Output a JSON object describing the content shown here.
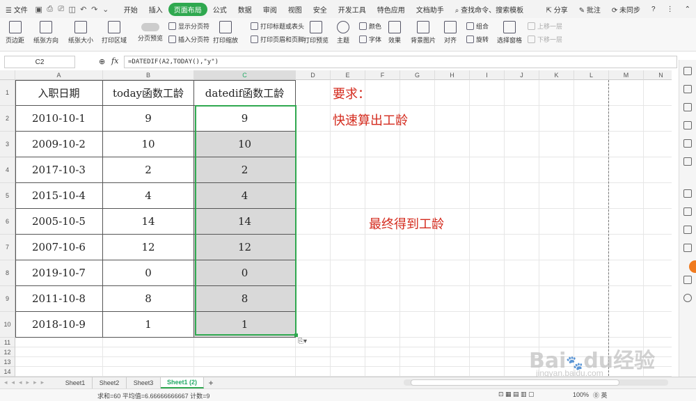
{
  "menu": {
    "file": "文件",
    "tabs": [
      "开始",
      "插入",
      "页面布局",
      "公式",
      "数据",
      "审阅",
      "视图",
      "安全",
      "开发工具",
      "特色应用",
      "文档助手"
    ],
    "active_tab": "页面布局",
    "search_placeholder": "查找命令、搜索模板",
    "share": "分享",
    "comment": "批注",
    "sync": "未同步",
    "help": "?"
  },
  "ribbon": {
    "margins": "页边距",
    "orientation": "纸张方向",
    "size": "纸张大小",
    "print_area": "打印区域",
    "page_break_preview": "分页预览",
    "show_page_break": "显示分页符",
    "insert_page_break": "插入分页符",
    "print_scale": "打印缩放",
    "print_titles": "打印标题或表头",
    "print_header_footer": "打印页眉和页脚",
    "print_preview": "打印预览",
    "theme": "主题",
    "colors": "颜色",
    "fonts": "字体",
    "effects": "效果",
    "background": "背景图片",
    "align": "对齐",
    "group": "组合",
    "rotate": "旋转",
    "selection_pane": "选择窗格",
    "bring_forward": "上移一层",
    "send_backward": "下移一层"
  },
  "formula_bar": {
    "name_box": "C2",
    "fx": "fx",
    "formula": "=DATEDIF(A2,TODAY(),\"y\")"
  },
  "columns": [
    "A",
    "B",
    "C",
    "D",
    "E",
    "F",
    "G",
    "H",
    "I",
    "J",
    "K",
    "L",
    "M",
    "N"
  ],
  "rows": [
    "1",
    "2",
    "3",
    "4",
    "5",
    "6",
    "7",
    "8",
    "9",
    "10",
    "11",
    "12",
    "13",
    "14"
  ],
  "table": {
    "headers": [
      "入职日期",
      "today函数工龄",
      "datedif函数工龄"
    ],
    "rows": [
      [
        "2010-10-1",
        "9",
        "9"
      ],
      [
        "2009-10-2",
        "10",
        "10"
      ],
      [
        "2017-10-3",
        "2",
        "2"
      ],
      [
        "2015-10-4",
        "4",
        "4"
      ],
      [
        "2005-10-5",
        "14",
        "14"
      ],
      [
        "2007-10-6",
        "12",
        "12"
      ],
      [
        "2019-10-7",
        "0",
        "0"
      ],
      [
        "2011-10-8",
        "8",
        "8"
      ],
      [
        "2018-10-9",
        "1",
        "1"
      ]
    ]
  },
  "notes": {
    "requirement": "要求：",
    "task": "快速算出工龄",
    "result": "最终得到工龄"
  },
  "sheets": [
    "Sheet1",
    "Sheet2",
    "Sheet3",
    "Sheet1 (2)"
  ],
  "active_sheet": "Sheet1 (2)",
  "status": {
    "summary": "求和=60  平均值=6.66666666667  计数=9",
    "zoom": "100%",
    "ime": "英"
  },
  "watermark": "Baidu经验 jingyan.baidu.com",
  "colors": {
    "accent": "#2fa84f",
    "note_red": "#d42b1e",
    "selection_fill": "#d9d9d9"
  }
}
